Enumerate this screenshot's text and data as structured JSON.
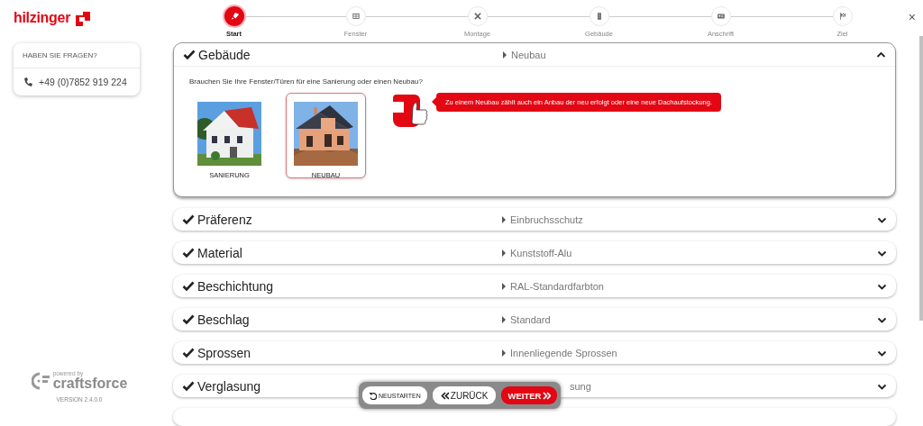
{
  "logo": {
    "text": "hilzinger"
  },
  "contact": {
    "title": "HABEN SIE FRAGEN?",
    "phone": "+49 (0)7852 919 224"
  },
  "branding": {
    "powered_by": "powered by",
    "name": "craftsforce",
    "version": "VERSION 2.4.0.0"
  },
  "close": "×",
  "steps": [
    {
      "label": "Start",
      "selected": true
    },
    {
      "label": "Fenster",
      "selected": false
    },
    {
      "label": "Montage",
      "selected": false
    },
    {
      "label": "Gebäude",
      "selected": false
    },
    {
      "label": "Anschrift",
      "selected": false
    },
    {
      "label": "Ziel",
      "selected": false
    }
  ],
  "sections": [
    {
      "title": "Gebäude",
      "value": "Neubau",
      "done": true,
      "expanded": true,
      "partly_hidden": false
    },
    {
      "title": "Präferenz",
      "value": "Einbruchsschutz",
      "done": true,
      "expanded": false,
      "partly_hidden": false
    },
    {
      "title": "Material",
      "value": "Kunststoff-Alu",
      "done": true,
      "expanded": false,
      "partly_hidden": false
    },
    {
      "title": "Beschichtung",
      "value": "RAL-Standardfarbton",
      "done": true,
      "expanded": false,
      "partly_hidden": false
    },
    {
      "title": "Beschlag",
      "value": "Standard",
      "done": true,
      "expanded": false,
      "partly_hidden": false
    },
    {
      "title": "Sprossen",
      "value": "Innenliegende Sprossen",
      "done": true,
      "expanded": false,
      "partly_hidden": false
    },
    {
      "title": "Verglasung",
      "value": "sung",
      "done": true,
      "expanded": false,
      "partly_hidden": true
    }
  ],
  "question": {
    "text": "Brauchen Sie Ihre Fenster/Türen für eine Sanierung oder einen Neubau?",
    "options": [
      {
        "label": "SANIERUNG",
        "selected": false,
        "kind": "renovation"
      },
      {
        "label": "NEUBAU",
        "selected": true,
        "kind": "newbuild"
      }
    ],
    "hint": "Zu einem Neubau zählt auch ein Anbau der neu erfolgt oder eine neue Dachaufstockung."
  },
  "actions": [
    {
      "kind": "restart",
      "label": "NEUSTARTEN"
    },
    {
      "kind": "back",
      "label": "ZURÜCK"
    },
    {
      "kind": "next",
      "label": "WEITER"
    }
  ]
}
